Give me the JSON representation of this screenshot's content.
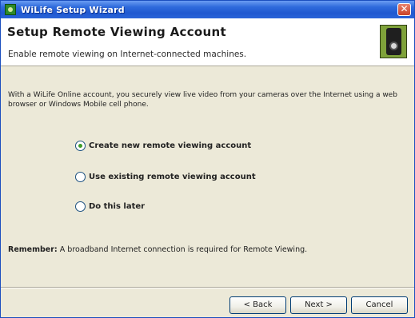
{
  "window": {
    "title": "WiLife Setup Wizard",
    "close_glyph": "✕"
  },
  "header": {
    "title": "Setup Remote Viewing Account",
    "subtitle": "Enable remote viewing on Internet-connected machines."
  },
  "body": {
    "intro": "With a WiLife Online account, you securely view live video from your cameras over the Internet using a web browser or Windows Mobile cell phone.",
    "options": [
      {
        "label": "Create new remote viewing account",
        "checked": true
      },
      {
        "label": "Use existing remote viewing account",
        "checked": false
      },
      {
        "label": "Do this later",
        "checked": false
      }
    ],
    "reminder_label": "Remember:",
    "reminder_text": "A broadband Internet connection is required for Remote Viewing."
  },
  "footer": {
    "back_label": "< Back",
    "next_label": "Next >",
    "cancel_label": "Cancel"
  },
  "icons": {
    "app": "wilife-app-icon",
    "header": "camera-icon"
  },
  "colors": {
    "titlebar": "#2f6bdc",
    "window_bg": "#ece9d8",
    "header_bg": "#ffffff",
    "radio_dot": "#3d9c2a"
  }
}
